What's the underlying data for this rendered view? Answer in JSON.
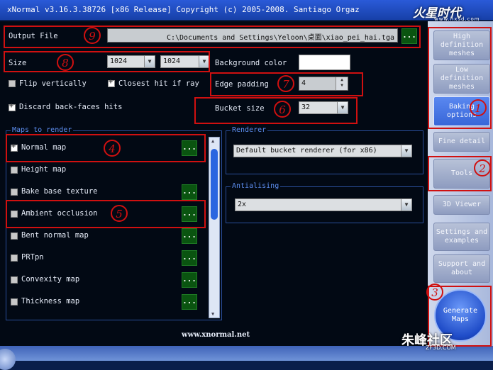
{
  "window": {
    "title": "xNormal v3.16.3.38726 [x86 Release] Copyright (c) 2005-2008. Santiago Orgaz"
  },
  "watermark_top": {
    "main": "火星时代",
    "sub": "www.hxsd.com"
  },
  "watermark_bottom": {
    "main": "朱峰社区",
    "sub": "ZF3D.COM"
  },
  "output_file": {
    "label": "Output File",
    "value": "C:\\Documents and Settings\\Yeloon\\桌面\\xiao_pei_hai.tga",
    "browse": "..."
  },
  "size": {
    "label": "Size",
    "width": "1024",
    "height": "1024"
  },
  "background_color": {
    "label": "Background color",
    "color": "#ffffff"
  },
  "options": {
    "flip_vertically": "Flip vertically",
    "closest_hit": "Closest hit if ray",
    "discard_back_faces": "Discard back-faces hits"
  },
  "edge_padding": {
    "label": "Edge padding",
    "value": "4"
  },
  "bucket_size": {
    "label": "Bucket size",
    "value": "32"
  },
  "maps_group": {
    "label": "Maps to render"
  },
  "maps": [
    {
      "label": "Normal map",
      "checked": true,
      "has_options": true
    },
    {
      "label": "Height map",
      "checked": false,
      "has_options": false
    },
    {
      "label": "Bake base texture",
      "checked": false,
      "has_options": true
    },
    {
      "label": "Ambient occlusion",
      "checked": false,
      "has_options": true
    },
    {
      "label": "Bent normal map",
      "checked": false,
      "has_options": true
    },
    {
      "label": "PRTpn",
      "checked": false,
      "has_options": true
    },
    {
      "label": "Convexity map",
      "checked": false,
      "has_options": true
    },
    {
      "label": "Thickness map",
      "checked": false,
      "has_options": true
    }
  ],
  "renderer": {
    "label": "Renderer",
    "value": "Default bucket renderer (for x86)"
  },
  "antialiasing": {
    "label": "Antialising",
    "value": "2x"
  },
  "footer": {
    "link": "www.xnormal.net"
  },
  "sidebar": {
    "items": [
      {
        "label": "High definition meshes"
      },
      {
        "label": "Low definition meshes"
      },
      {
        "label": "Baking options"
      },
      {
        "label": "Fine detail"
      },
      {
        "label": "Tools"
      },
      {
        "label": "3D Viewer"
      },
      {
        "label": "Settings and examples"
      },
      {
        "label": "Support and about"
      }
    ],
    "generate": "Generate Maps"
  },
  "annotations": [
    "9",
    "8",
    "7",
    "6",
    "4",
    "5",
    "1",
    "2",
    "3"
  ],
  "colors": {
    "accent": "#3866d8",
    "annotation": "#d01010",
    "panel": "#020914",
    "ok_button": "#0a5410"
  }
}
